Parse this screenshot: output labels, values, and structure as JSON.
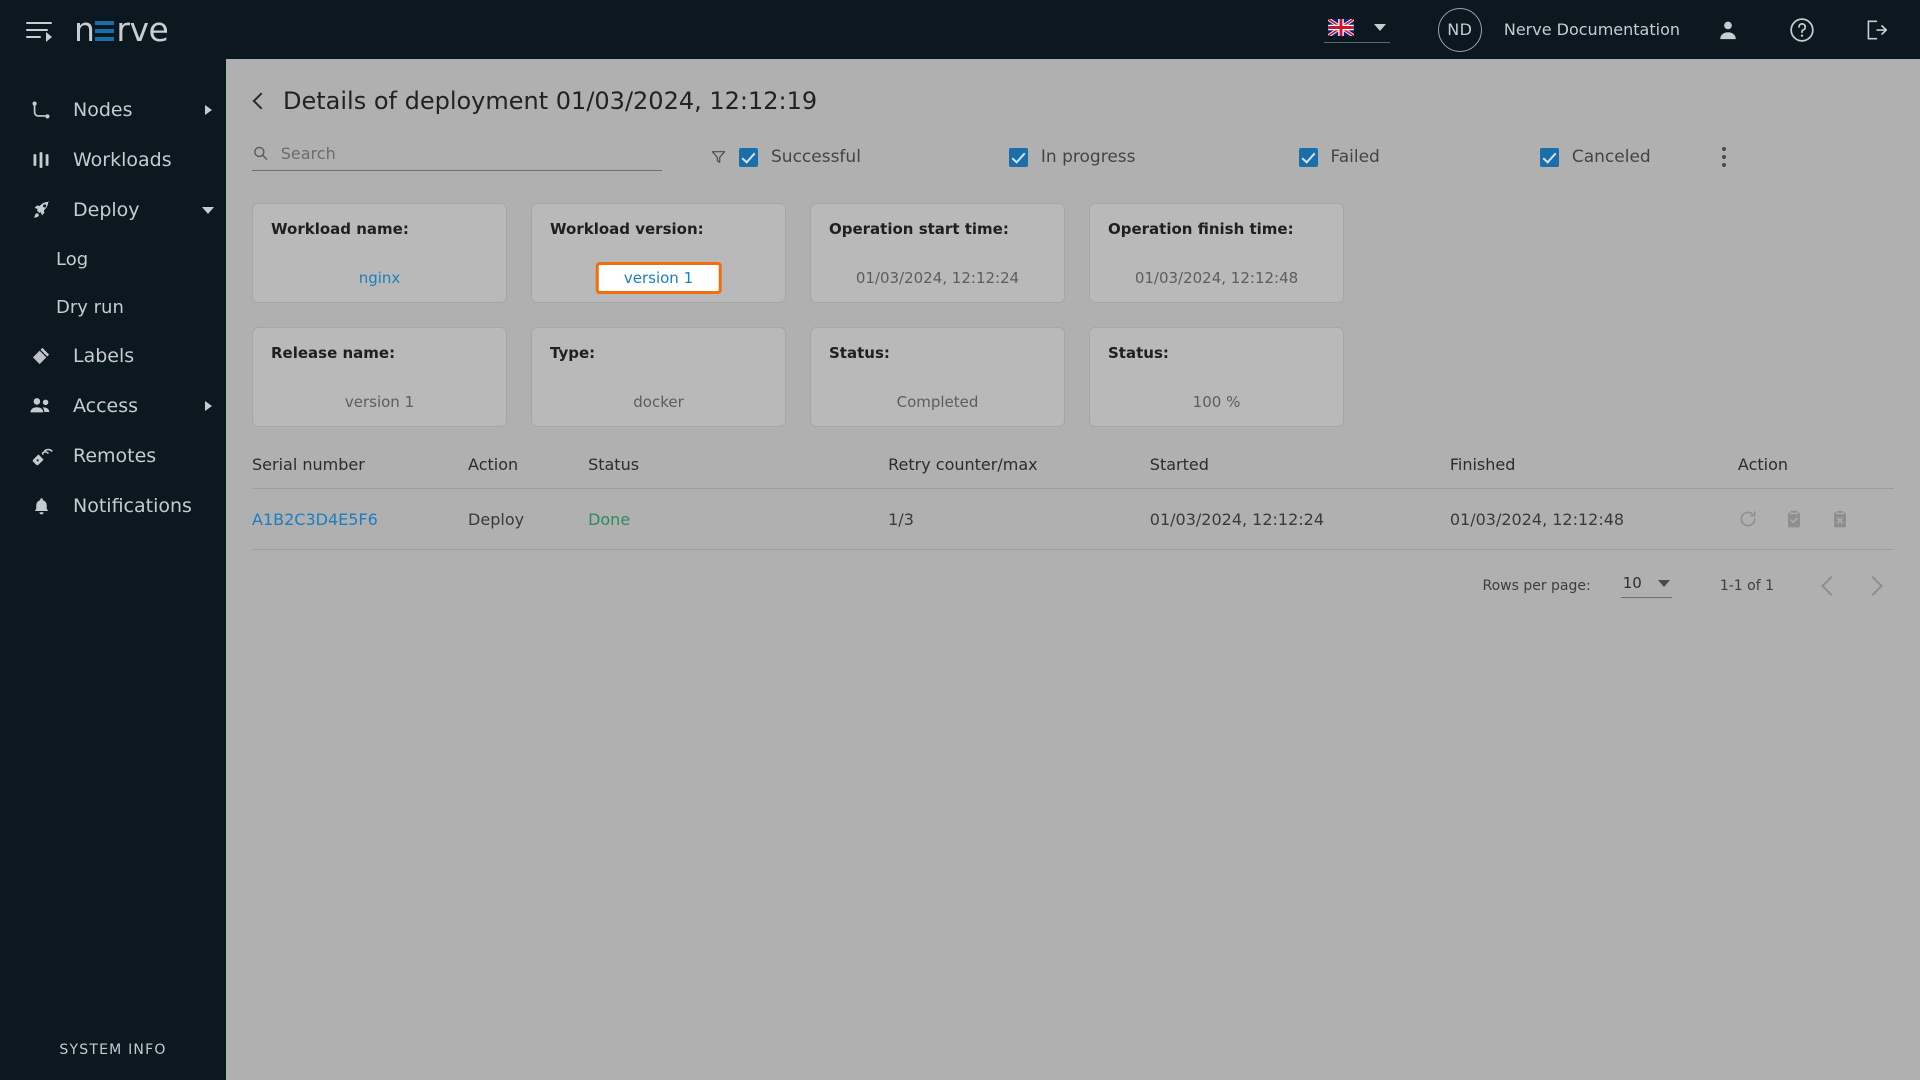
{
  "topbar": {
    "menu_icon": "hamburger-menu-icon",
    "logo_text": "nerve",
    "language_flag": "uk-flag-icon",
    "avatar_initials": "ND",
    "org_name": "Nerve Documentation",
    "icons": [
      "user-icon",
      "help-icon",
      "logout-icon"
    ],
    "accent_color": "#1b6fa8"
  },
  "sidebar": {
    "items": [
      {
        "label": "Nodes",
        "icon": "nodes-icon",
        "expandable": "right"
      },
      {
        "label": "Workloads",
        "icon": "workloads-icon",
        "expandable": "none"
      },
      {
        "label": "Deploy",
        "icon": "deploy-rocket-icon",
        "expandable": "down"
      },
      {
        "label": "Log",
        "icon": "none",
        "expandable": "none",
        "sub": true
      },
      {
        "label": "Dry run",
        "icon": "none",
        "expandable": "none",
        "sub": true
      },
      {
        "label": "Labels",
        "icon": "labels-icon",
        "expandable": "none"
      },
      {
        "label": "Access",
        "icon": "access-users-icon",
        "expandable": "right"
      },
      {
        "label": "Remotes",
        "icon": "remotes-icon",
        "expandable": "none"
      },
      {
        "label": "Notifications",
        "icon": "bell-icon",
        "expandable": "none"
      }
    ],
    "system_info": "SYSTEM INFO"
  },
  "page": {
    "title": "Details of deployment 01/03/2024, 12:12:19"
  },
  "filters": {
    "search_placeholder": "Search",
    "search_value": "",
    "funnel_icon": "filter-funnel-icon",
    "checkboxes": [
      {
        "label": "Successful",
        "checked": true
      },
      {
        "label": "In progress",
        "checked": true
      },
      {
        "label": "Failed",
        "checked": true
      },
      {
        "label": "Canceled",
        "checked": true
      }
    ],
    "overflow_icon": "more-vertical-icon"
  },
  "cards": [
    {
      "label": "Workload name:",
      "value": "nginx",
      "style": "link"
    },
    {
      "label": "Workload version:",
      "value": "version 1",
      "style": "highlight"
    },
    {
      "label": "Operation start time:",
      "value": "01/03/2024, 12:12:24",
      "style": "plain"
    },
    {
      "label": "Operation finish time:",
      "value": "01/03/2024, 12:12:48",
      "style": "plain"
    },
    {
      "label": "Release name:",
      "value": "version 1",
      "style": "plain"
    },
    {
      "label": "Type:",
      "value": "docker",
      "style": "plain"
    },
    {
      "label": "Status:",
      "value": "Completed",
      "style": "plain"
    },
    {
      "label": "Status:",
      "value": "100 %",
      "style": "plain"
    }
  ],
  "table": {
    "columns": [
      "Serial number",
      "Action",
      "Status",
      "Retry counter/max",
      "Started",
      "Finished",
      "Action"
    ],
    "rows": [
      {
        "serial": "A1B2C3D4E5F6",
        "action": "Deploy",
        "status": "Done",
        "retry": "1/3",
        "started": "01/03/2024, 12:12:24",
        "finished": "01/03/2024, 12:12:48",
        "action_icons": [
          "retry-icon",
          "clipboard-check-icon",
          "clipboard-cancel-icon"
        ]
      }
    ]
  },
  "pagination": {
    "rows_per_page_label": "Rows per page:",
    "rows_per_page_value": "10",
    "range_label": "1-1 of 1",
    "prev_icon": "chevron-left-icon",
    "next_icon": "chevron-right-icon"
  },
  "colors": {
    "brand_blue": "#1b6fa8",
    "link_blue": "#1b7fbf",
    "status_green": "#2f8a5f",
    "highlight_orange": "#f26d0d",
    "dark_bg": "#0b1820",
    "page_bg": "#b0b0b0"
  }
}
